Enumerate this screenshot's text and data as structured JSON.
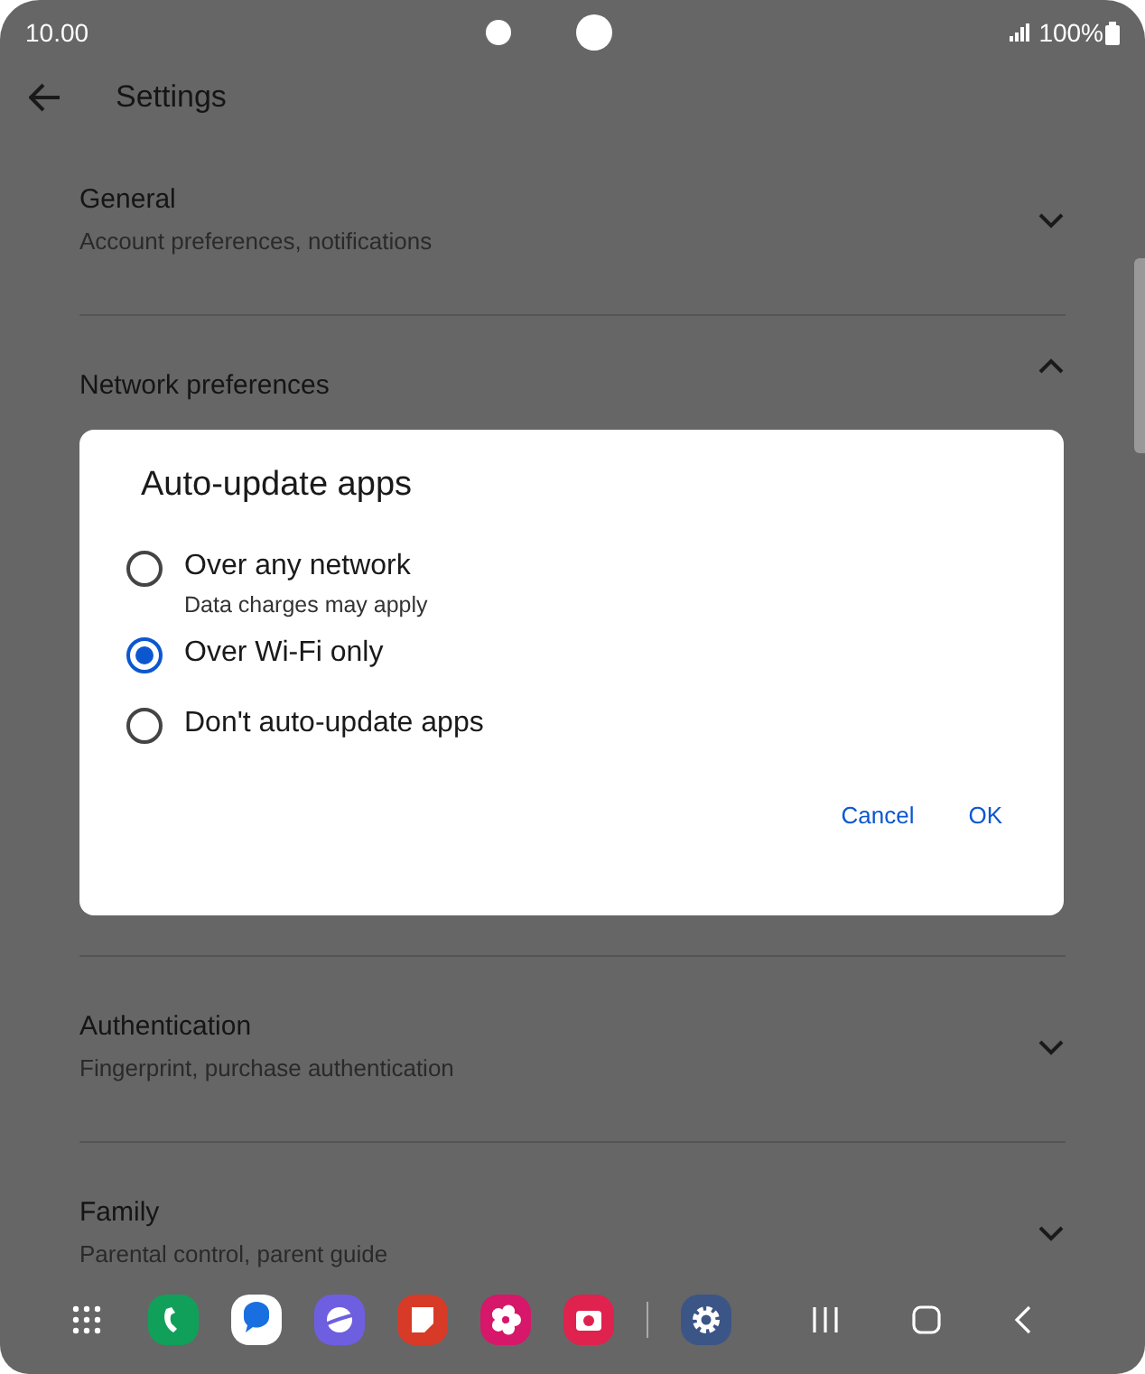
{
  "status_bar": {
    "time": "10.00",
    "battery": "100%"
  },
  "header": {
    "title": "Settings"
  },
  "sections": [
    {
      "title": "General",
      "subtitle": "Account preferences, notifications",
      "expanded": false
    },
    {
      "title": "Network preferences",
      "expanded": true
    },
    {
      "title": "Authentication",
      "subtitle": "Fingerprint, purchase authentication",
      "expanded": false
    },
    {
      "title": "Family",
      "subtitle": "Parental control, parent guide",
      "expanded": false
    }
  ],
  "dialog": {
    "title": "Auto-update apps",
    "options": [
      {
        "label": "Over any network",
        "subtitle": "Data charges may apply",
        "selected": false
      },
      {
        "label": "Over Wi-Fi only",
        "selected": true
      },
      {
        "label": "Don't auto-update apps",
        "selected": false
      }
    ],
    "buttons": [
      "Cancel",
      "OK"
    ]
  }
}
